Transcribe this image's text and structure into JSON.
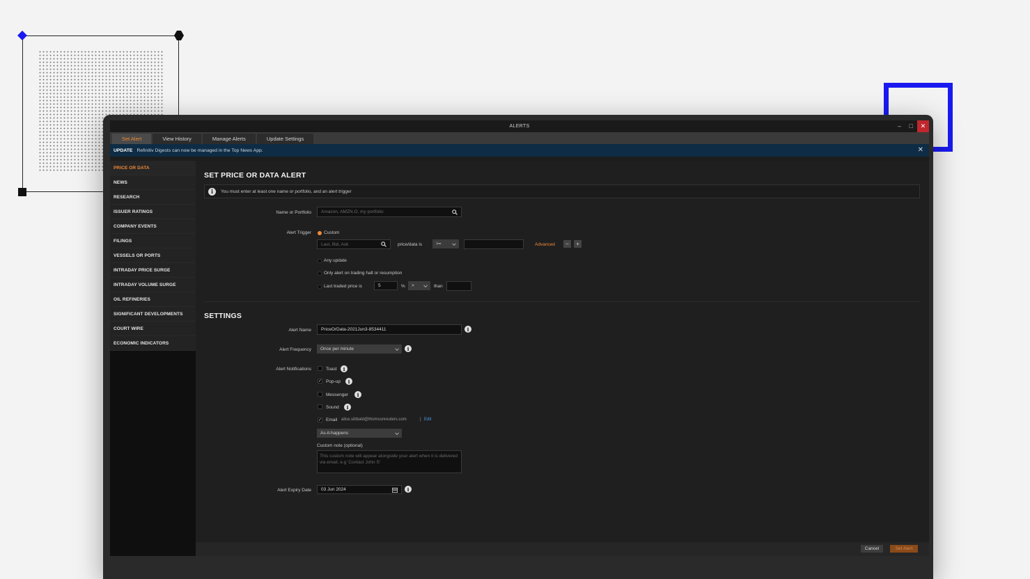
{
  "window": {
    "title": "ALERTS"
  },
  "tabs": [
    {
      "label": "Set Alert",
      "active": true
    },
    {
      "label": "View History",
      "active": false
    },
    {
      "label": "Manage Alerts",
      "active": false
    },
    {
      "label": "Update Settings",
      "active": false
    }
  ],
  "banner": {
    "tag": "UPDATE",
    "message": "Refinitiv Digests can now be managed in the Top News App."
  },
  "sidebar": {
    "items": [
      "PRICE OR DATA",
      "NEWS",
      "RESEARCH",
      "ISSUER RATINGS",
      "COMPANY EVENTS",
      "FILINGS",
      "VESSELS OR PORTS",
      "INTRADAY PRICE SURGE",
      "INTRADAY VOLUME SURGE",
      "OIL REFINERIES",
      "SIGNIFICANT DEVELOPMENTS",
      "COURT WIRE",
      "ECONOMIC INDICATORS"
    ],
    "active_index": 0
  },
  "alert": {
    "section_title": "SET PRICE OR DATA ALERT",
    "info_message": "You must enter at least one name or portfolio, and an alert trigger",
    "name_label": "Name or Portfolio",
    "name_placeholder": "Amazon, AMZN.O, my portfolio",
    "trigger_label": "Alert Trigger",
    "custom_label": "Custom",
    "field_placeholder": "Last, Bid, Ask",
    "price_data_is": "price/data is",
    "operator": ">=",
    "value": "",
    "advanced_label": "Advanced",
    "minus": "−",
    "plus": "+",
    "any_update": "Any update",
    "halt_resumption": "Only alert on trading halt or resumption",
    "last_traded_label": "Last traded price is",
    "last_traded_value": "5",
    "percent": "%",
    "compare_op": ">",
    "than": "than",
    "than_value": ""
  },
  "settings": {
    "section_title": "SETTINGS",
    "alert_name_label": "Alert Name",
    "alert_name_value": "PriceOrData-2021Jun3-8534411",
    "frequency_label": "Alert Frequency",
    "frequency_value": "Once per minute",
    "notifications_label": "Alert Notifications",
    "notifications": [
      {
        "label": "Toast",
        "checked": false
      },
      {
        "label": "Pop-up",
        "checked": true
      },
      {
        "label": "Messenger",
        "checked": false
      },
      {
        "label": "Sound",
        "checked": false
      }
    ],
    "email_label": "Email",
    "email_address": "alice.sibbald@thomsonreuters.com",
    "email_sep": "|",
    "edit_label": "Edit",
    "email_checked": true,
    "email_frequency": "As-it-happens",
    "custom_note_label": "Custom note (optional)",
    "custom_note_placeholder": "This custom note will appear alongside your alert when it is delivered via email, e.g 'Contact John S'",
    "expiry_label": "Alert Expiry Date",
    "expiry_value": "03 Jun 2024"
  },
  "footer": {
    "cancel_label": "Cancel",
    "set_alert_label": "Set Alert"
  },
  "colors": {
    "accent": "#f08a38",
    "banner": "#0e2c45",
    "close": "#c0262d",
    "deco_blue": "#1a1af0"
  }
}
